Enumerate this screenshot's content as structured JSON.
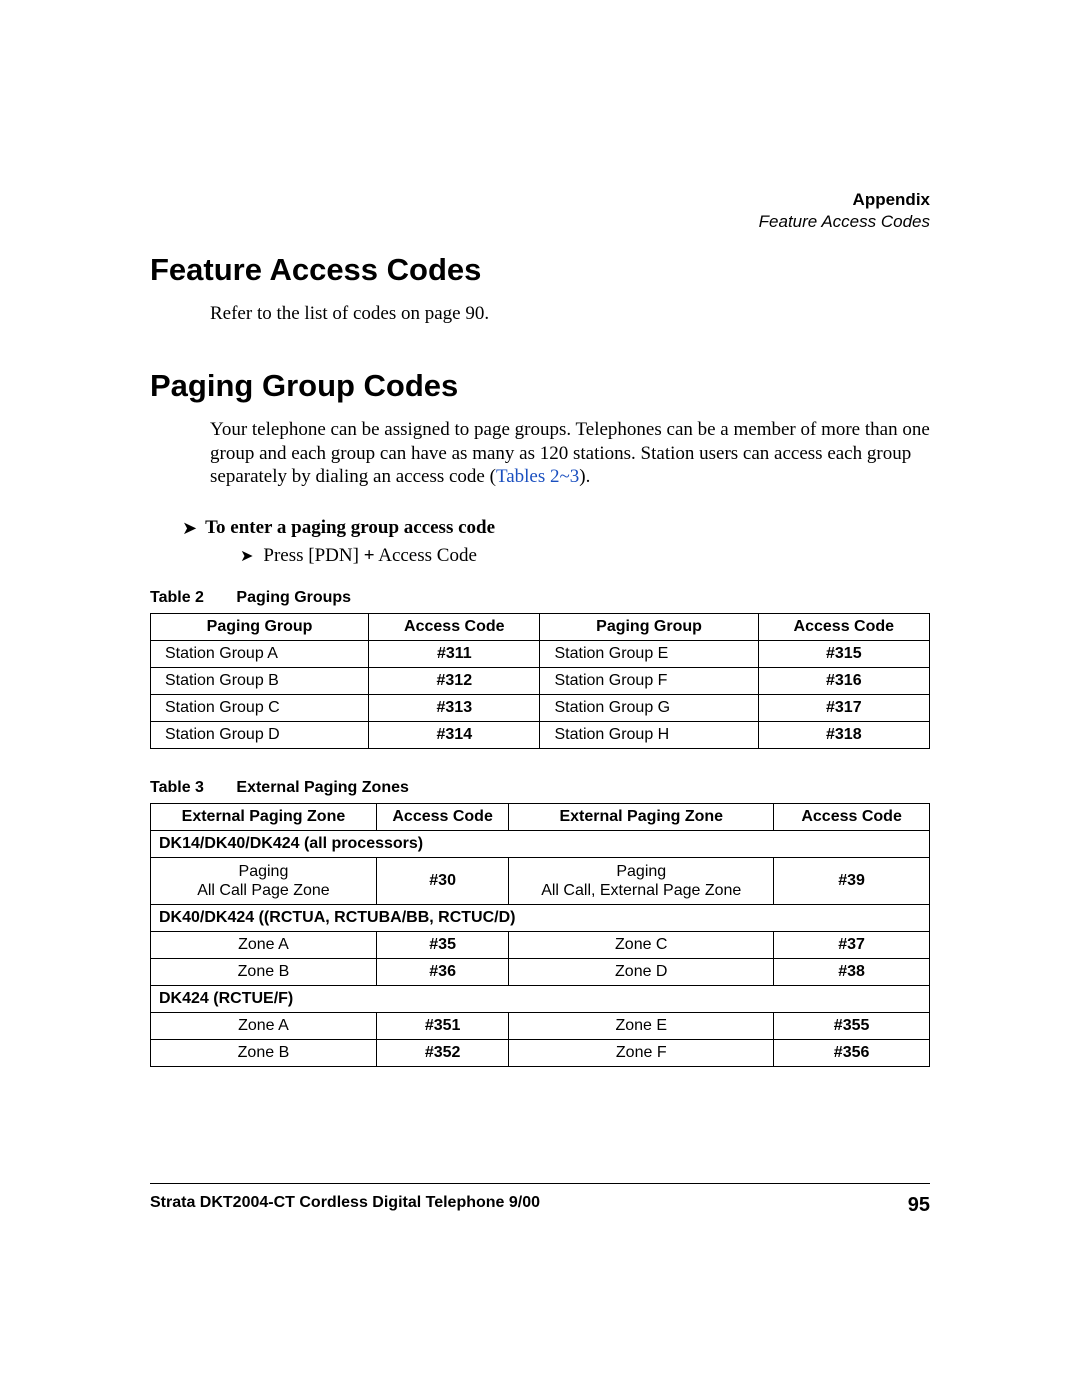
{
  "header": {
    "appendix": "Appendix",
    "subtitle": "Feature Access Codes"
  },
  "section1": {
    "title": "Feature Access Codes",
    "body": "Refer to the list of codes on page 90."
  },
  "section2": {
    "title": "Paging Group Codes",
    "body_pre": "Your telephone can be assigned to page groups. Telephones can be a member of more than one group and each group can have as many as 120 stations. Station users can access each group separately by dialing an access code (",
    "body_link": "Tables 2~3",
    "body_post": ").",
    "step_title": "To enter a paging group access code",
    "step_action_pre": "Press [PDN] ",
    "step_action_plus": "+",
    "step_action_post": " Access Code"
  },
  "table2": {
    "caption_label": "Table 2",
    "caption_title": "Paging Groups",
    "headers": [
      "Paging Group",
      "Access Code",
      "Paging Group",
      "Access Code"
    ],
    "rows": [
      {
        "g1": "Station Group A",
        "c1": "#311",
        "g2": "Station Group E",
        "c2": "#315"
      },
      {
        "g1": "Station Group B",
        "c1": "#312",
        "g2": "Station Group F",
        "c2": "#316"
      },
      {
        "g1": "Station Group C",
        "c1": "#313",
        "g2": "Station Group G",
        "c2": "#317"
      },
      {
        "g1": "Station Group D",
        "c1": "#314",
        "g2": "Station Group H",
        "c2": "#318"
      }
    ]
  },
  "table3": {
    "caption_label": "Table 3",
    "caption_title": "External Paging Zones",
    "headers": [
      "External Paging Zone",
      "Access Code",
      "External Paging Zone",
      "Access Code"
    ],
    "group1": {
      "title": "DK14/DK40/DK424 (all processors)",
      "row": {
        "z1a": "Paging",
        "z1b": "All Call Page Zone",
        "c1": "#30",
        "z2a": "Paging",
        "z2b": "All Call, External Page Zone",
        "c2": "#39"
      }
    },
    "group2": {
      "title": "DK40/DK424 ((RCTUA, RCTUBA/BB, RCTUC/D)",
      "rows": [
        {
          "z1": "Zone A",
          "c1": "#35",
          "z2": "Zone C",
          "c2": "#37"
        },
        {
          "z1": "Zone B",
          "c1": "#36",
          "z2": "Zone D",
          "c2": "#38"
        }
      ]
    },
    "group3": {
      "title": "DK424 (RCTUE/F)",
      "rows": [
        {
          "z1": "Zone A",
          "c1": "#351",
          "z2": "Zone E",
          "c2": "#355"
        },
        {
          "z1": "Zone B",
          "c1": "#352",
          "z2": "Zone F",
          "c2": "#356"
        }
      ]
    }
  },
  "footer": {
    "left": "Strata DKT2004-CT Cordless Digital Telephone   9/00",
    "page": "95"
  }
}
